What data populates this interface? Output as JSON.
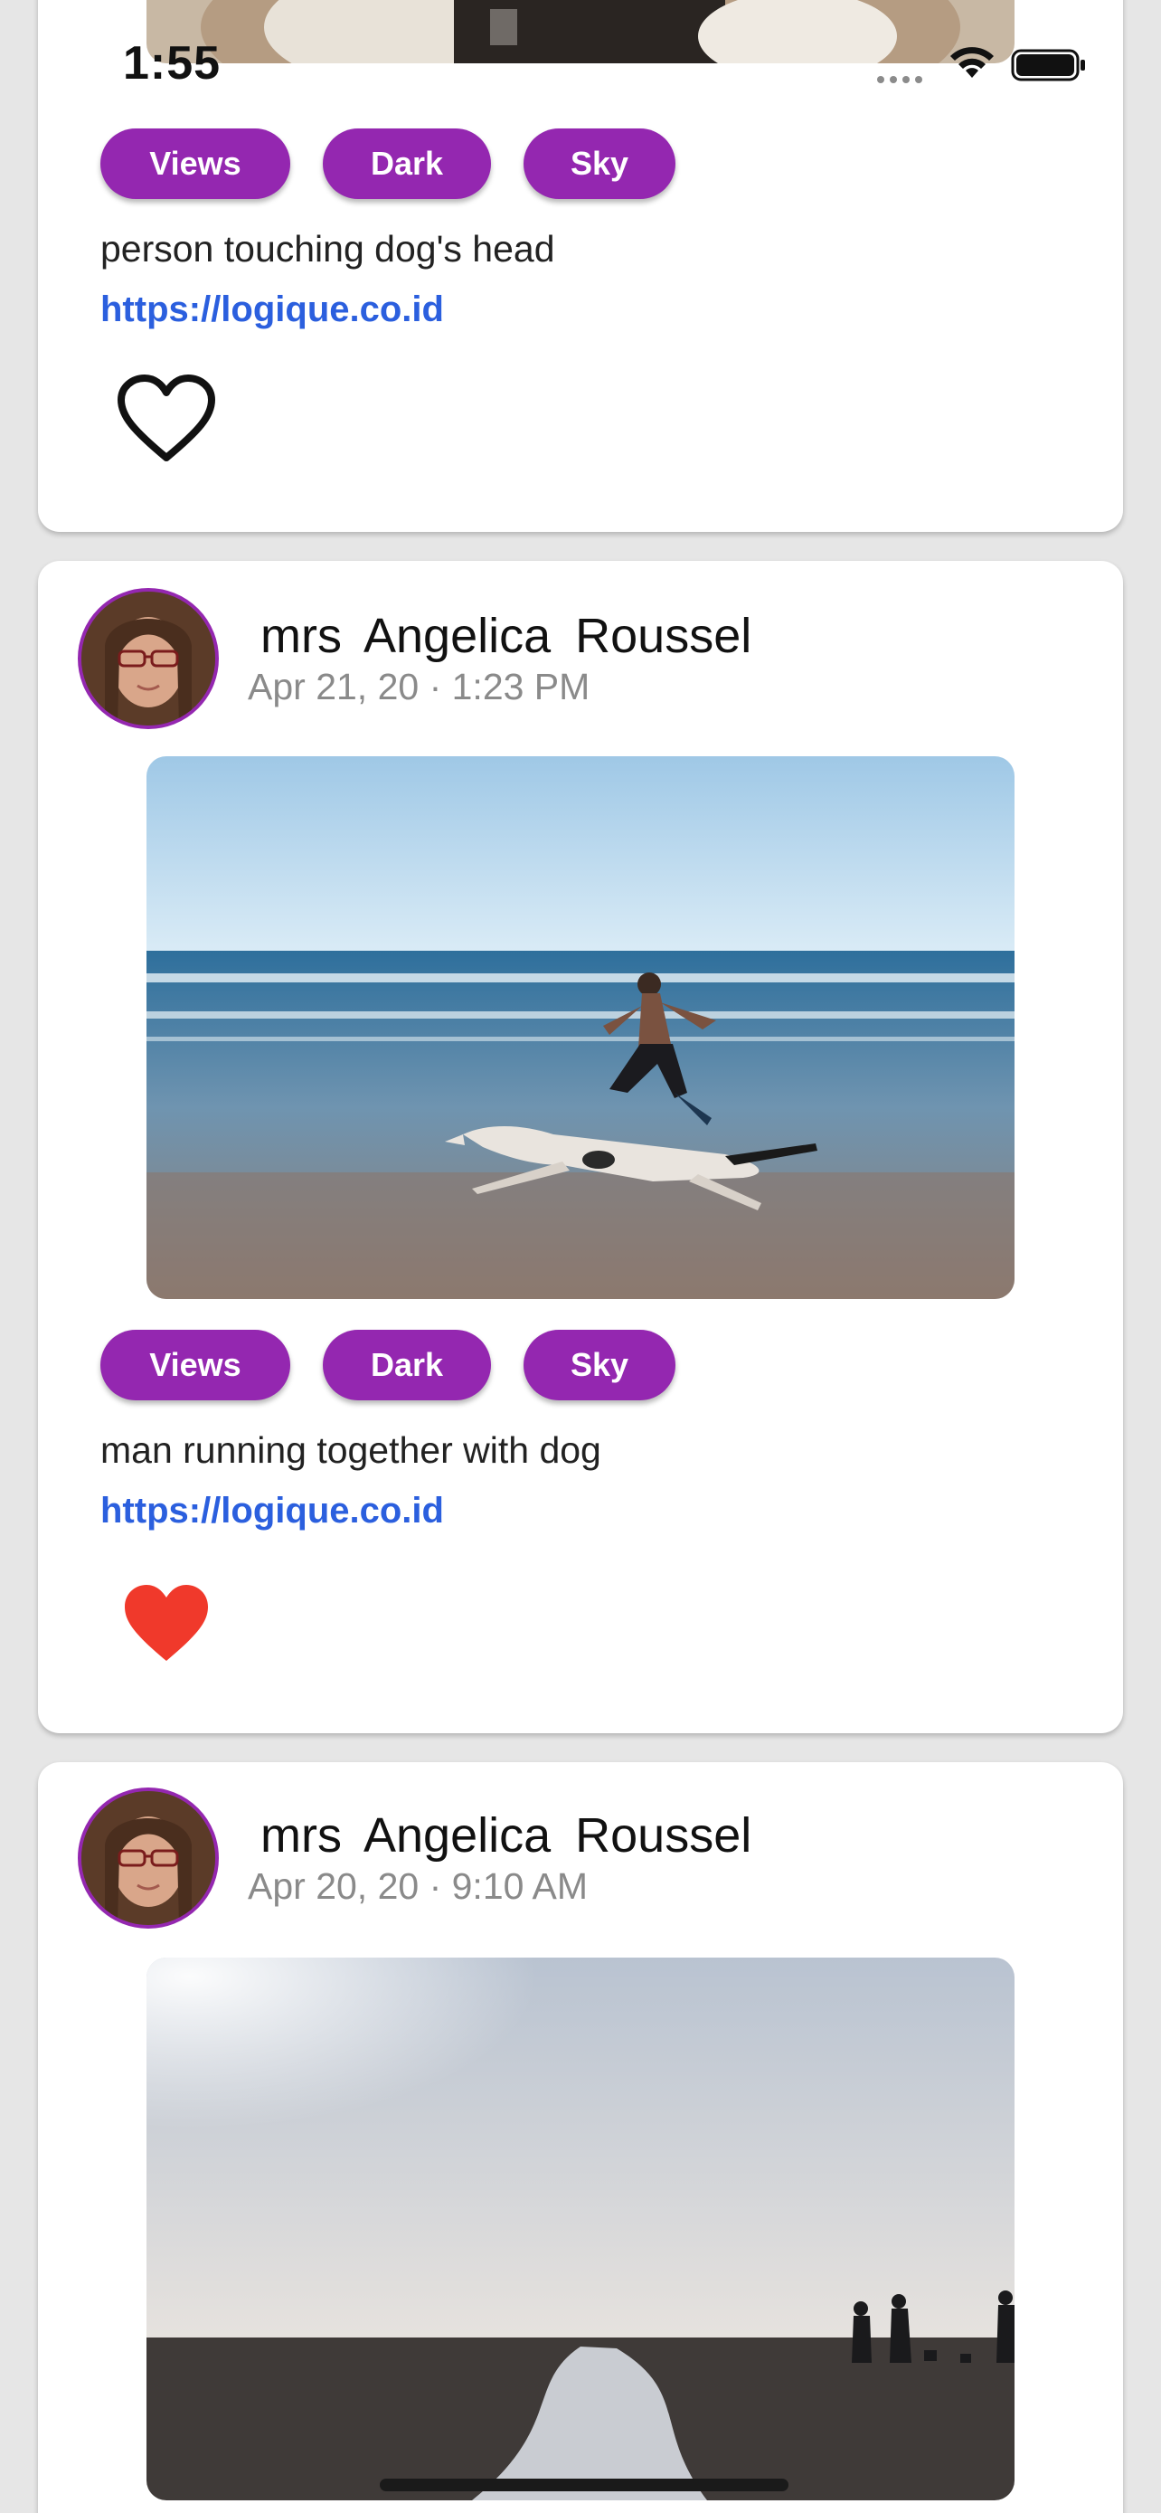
{
  "status_bar": {
    "time": "1:55"
  },
  "tag_color": "#9427b0",
  "link_color": "#2b5fde",
  "posts": [
    {
      "tags": [
        "Views",
        "Dark",
        "Sky"
      ],
      "caption": "person touching dog's head",
      "link": "https://logique.co.id",
      "liked": false
    },
    {
      "author": "mrs  Angelica  Roussel",
      "date": "Apr 21, 20 · 1:23 PM",
      "tags": [
        "Views",
        "Dark",
        "Sky"
      ],
      "caption": "man running together with dog",
      "link": "https://logique.co.id",
      "liked": true
    },
    {
      "author": "mrs  Angelica  Roussel",
      "date": "Apr 20, 20 · 9:10 AM"
    }
  ]
}
